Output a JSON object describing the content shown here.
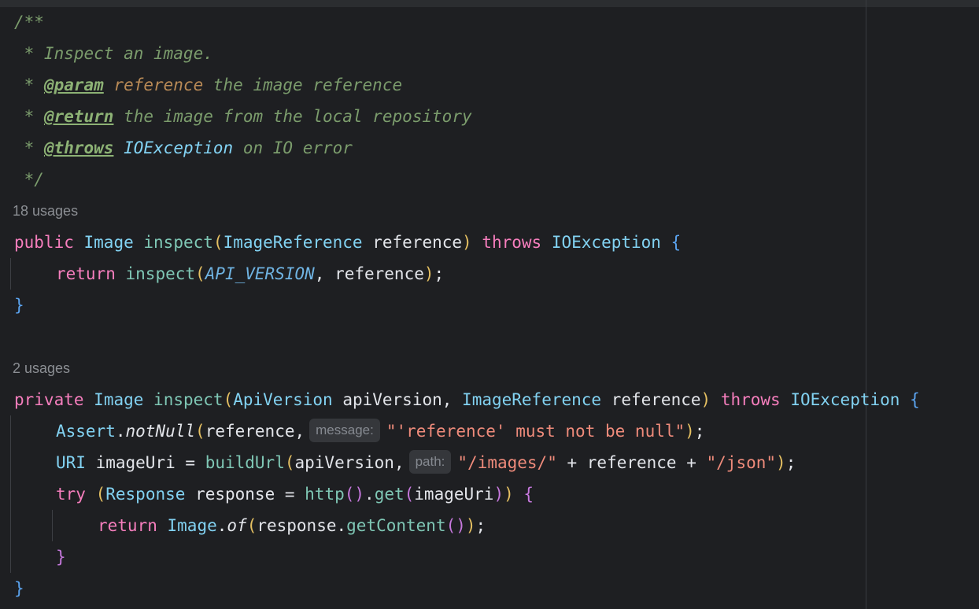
{
  "doc_comment": {
    "open": "/**",
    "summary": " * Inspect an image.",
    "param_line": {
      "star": " * ",
      "tag": "@param",
      "name": "reference",
      "text": " the image reference"
    },
    "return_line": {
      "star": " * ",
      "tag": "@return",
      "text": " the image from the local repository"
    },
    "throws_line": {
      "star": " * ",
      "tag": "@throws",
      "exception": "IOException",
      "text": " on IO error"
    },
    "close": " */"
  },
  "method1": {
    "usages": "18 usages",
    "modifier": "public",
    "return_type": "Image",
    "name": "inspect",
    "param_type": "ImageReference",
    "param_name": "reference",
    "throws_kw": "throws",
    "exception": "IOException",
    "body_keyword": "return",
    "call_name": "inspect",
    "constant": "API_VERSION",
    "arg": "reference"
  },
  "method2": {
    "usages": "2 usages",
    "modifier": "private",
    "return_type": "Image",
    "name": "inspect",
    "param1_type": "ApiVersion",
    "param1_name": "apiVersion",
    "param2_type": "ImageReference",
    "param2_name": "reference",
    "throws_kw": "throws",
    "exception": "IOException",
    "assert_class": "Assert",
    "assert_method": "notNull",
    "assert_arg": "reference",
    "message_hint": "message:",
    "message_string": "\"'reference' must not be null\"",
    "uri_type": "URI",
    "uri_var": "imageUri",
    "build_fn": "buildUrl",
    "build_arg": "apiVersion",
    "path_hint": "path:",
    "path_str1": "\"/images/\"",
    "path_ref": "reference",
    "path_str2": "\"/json\"",
    "try_kw": "try",
    "response_type": "Response",
    "response_var": "response",
    "http_fn": "http",
    "get_fn": "get",
    "get_arg": "imageUri",
    "inner_return": "return",
    "image_class": "Image",
    "of_method": "of",
    "content_obj": "response",
    "get_content": "getContent"
  }
}
